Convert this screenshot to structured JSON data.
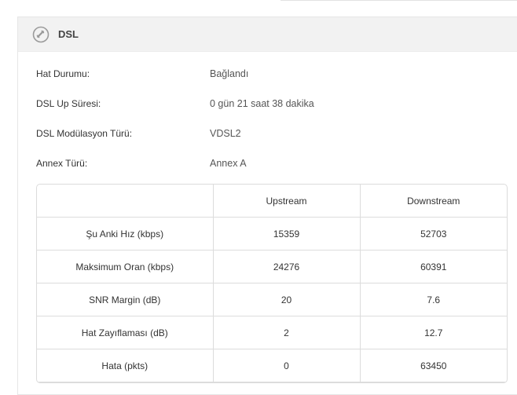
{
  "panel": {
    "title": "DSL",
    "icon": "phone-icon"
  },
  "info": {
    "line_status_label": "Hat Durumu:",
    "line_status_value": "Bağlandı",
    "uptime_label": "DSL Up Süresi:",
    "uptime_value": "0 gün 21 saat 38 dakika",
    "modulation_label": "DSL Modülasyon Türü:",
    "modulation_value": "VDSL2",
    "annex_label": "Annex Türü:",
    "annex_value": "Annex A"
  },
  "table": {
    "headers": [
      "",
      "Upstream",
      "Downstream"
    ],
    "rows": [
      {
        "label": "Şu Anki Hız (kbps)",
        "upstream": "15359",
        "downstream": "52703"
      },
      {
        "label": "Maksimum Oran (kbps)",
        "upstream": "24276",
        "downstream": "60391"
      },
      {
        "label": "SNR Margin (dB)",
        "upstream": "20",
        "downstream": "7.6"
      },
      {
        "label": "Hat Zayıflaması (dB)",
        "upstream": "2",
        "downstream": "12.7"
      },
      {
        "label": "Hata (pkts)",
        "upstream": "0",
        "downstream": "63450"
      }
    ]
  }
}
